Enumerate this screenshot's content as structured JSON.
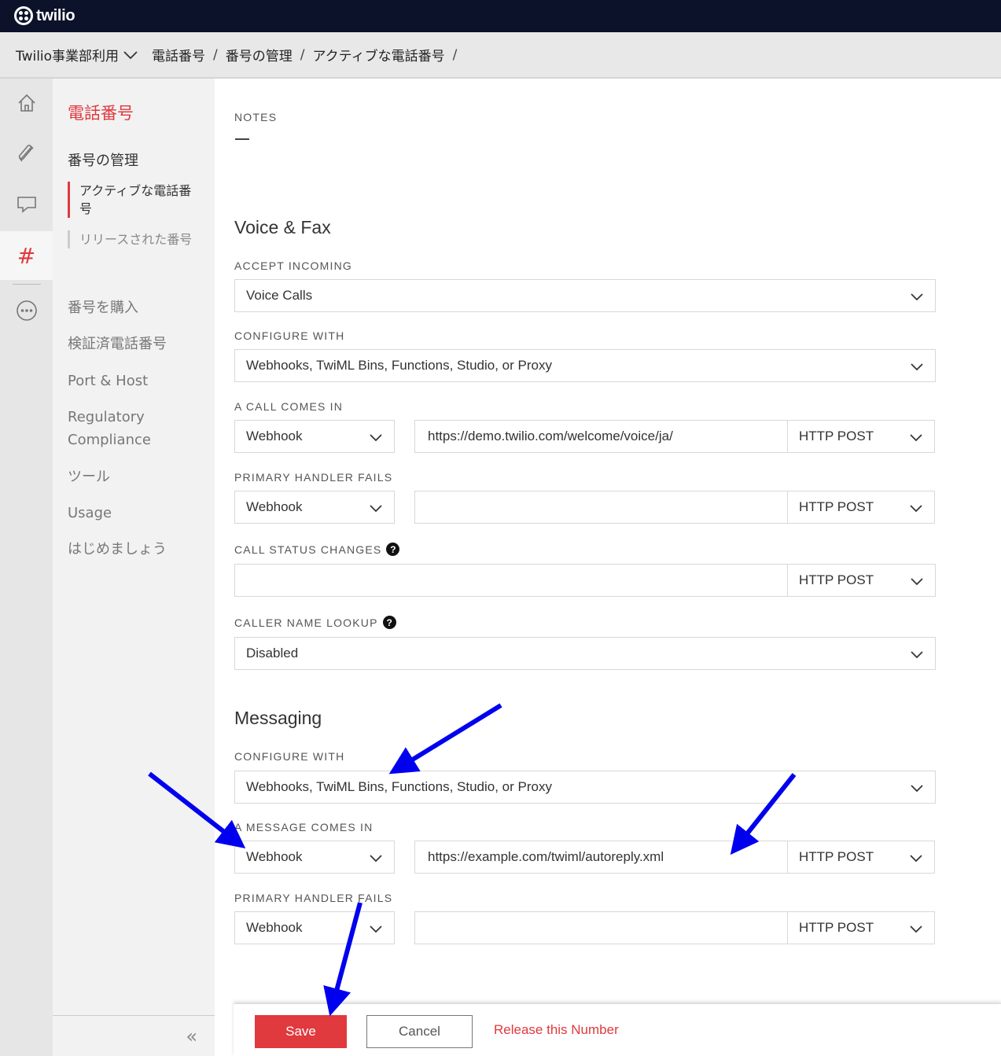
{
  "app": {
    "brand": "twilio"
  },
  "breadcrumb": {
    "account": "Twilio事業部利用",
    "items": [
      "電話番号",
      "番号の管理",
      "アクティブな電話番号"
    ],
    "separator": "/"
  },
  "rail": {
    "items": [
      "home-icon",
      "phone-icon",
      "chat-icon",
      "hash-icon",
      "more-icon"
    ],
    "active": "hash-icon",
    "hash_glyph": "#"
  },
  "nav": {
    "title": "電話番号",
    "section": "番号の管理",
    "children": [
      {
        "label": "アクティブな電話番号",
        "active": true
      },
      {
        "label": "リリースされた番号",
        "active": false
      }
    ],
    "items": [
      "番号を購入",
      "検証済電話番号",
      "Port & Host",
      "Regulatory Compliance",
      "ツール",
      "Usage",
      "はじめましょう"
    ],
    "collapse_glyph": "«"
  },
  "notes": {
    "label": "NOTES"
  },
  "voice": {
    "title": "Voice & Fax",
    "accept_incoming": {
      "label": "ACCEPT INCOMING",
      "value": "Voice Calls"
    },
    "configure_with": {
      "label": "CONFIGURE WITH",
      "value": "Webhooks, TwiML Bins, Functions, Studio, or Proxy"
    },
    "call_comes_in": {
      "label": "A CALL COMES IN",
      "type": "Webhook",
      "url": "https://demo.twilio.com/welcome/voice/ja/",
      "method": "HTTP POST"
    },
    "primary_handler_fails": {
      "label": "PRIMARY HANDLER FAILS",
      "type": "Webhook",
      "url": "",
      "method": "HTTP POST"
    },
    "call_status_changes": {
      "label": "CALL STATUS CHANGES",
      "url": "",
      "method": "HTTP POST"
    },
    "caller_name_lookup": {
      "label": "CALLER NAME LOOKUP",
      "value": "Disabled"
    },
    "help_glyph": "?"
  },
  "messaging": {
    "title": "Messaging",
    "configure_with": {
      "label": "CONFIGURE WITH",
      "value": "Webhooks, TwiML Bins, Functions, Studio, or Proxy"
    },
    "message_comes_in": {
      "label": "A MESSAGE COMES IN",
      "type": "Webhook",
      "url": "https://example.com/twiml/autoreply.xml",
      "method": "HTTP POST"
    },
    "primary_handler_fails": {
      "label": "PRIMARY HANDLER FAILS",
      "type": "Webhook",
      "url": "",
      "method": "HTTP POST"
    }
  },
  "actions": {
    "save": "Save",
    "cancel": "Cancel",
    "release": "Release this Number"
  },
  "colors": {
    "accent": "#e0393e",
    "topbar": "#0d122b",
    "annotation_arrow": "#0000ee"
  }
}
